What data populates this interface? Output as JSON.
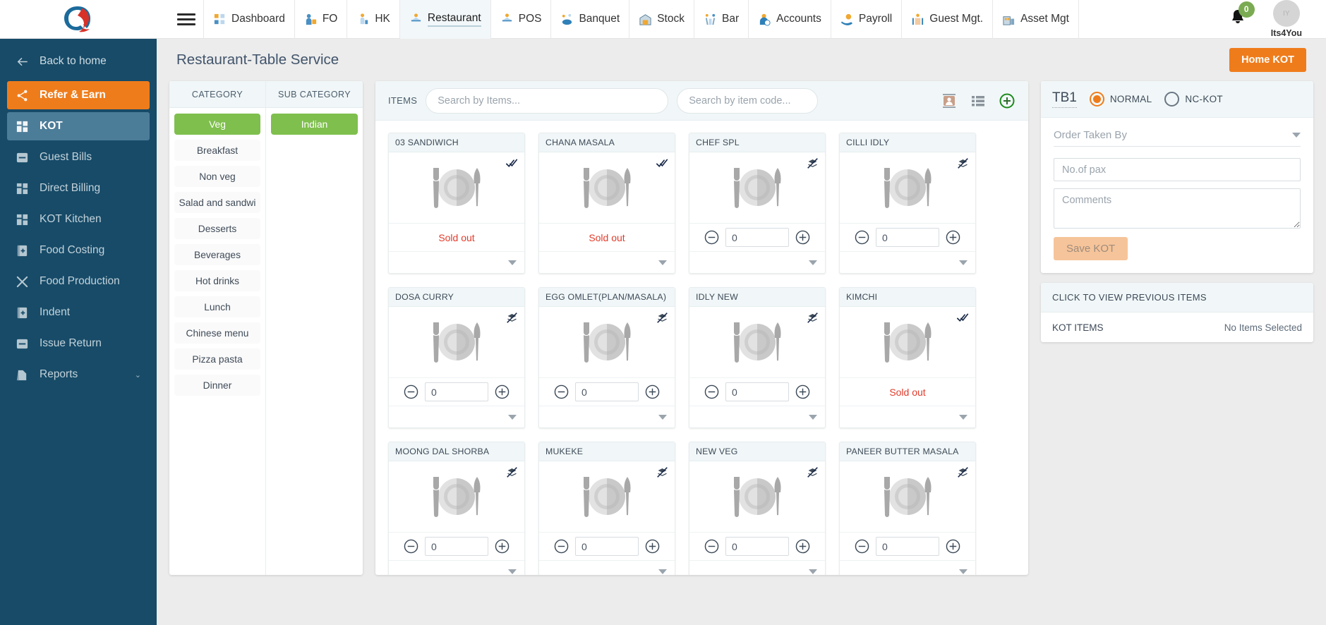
{
  "topnav": {
    "logo_alt": "qualitech-logo",
    "menu_items": [
      {
        "label": "Dashboard",
        "icon": "dashboard-icon",
        "active": false
      },
      {
        "label": "FO",
        "icon": "front-office-icon",
        "active": false
      },
      {
        "label": "HK",
        "icon": "housekeeping-icon",
        "active": false
      },
      {
        "label": "Restaurant",
        "icon": "restaurant-icon",
        "active": true
      },
      {
        "label": "POS",
        "icon": "pos-icon",
        "active": false
      },
      {
        "label": "Banquet",
        "icon": "banquet-icon",
        "active": false
      },
      {
        "label": "Stock",
        "icon": "stock-icon",
        "active": false
      },
      {
        "label": "Bar",
        "icon": "bar-icon",
        "active": false
      },
      {
        "label": "Accounts",
        "icon": "accounts-icon",
        "active": false
      },
      {
        "label": "Payroll",
        "icon": "payroll-icon",
        "active": false
      },
      {
        "label": "Guest Mgt.",
        "icon": "guest-management-icon",
        "active": false
      },
      {
        "label": "Asset Mgt",
        "icon": "asset-management-icon",
        "active": false
      }
    ],
    "notification_count": "0",
    "user_name": "Its4You",
    "avatar_initials": "IY"
  },
  "sidebar": {
    "back_label": "Back to home",
    "items": [
      {
        "label": "Refer & Earn",
        "icon": "share-icon",
        "state": "refer"
      },
      {
        "label": "KOT",
        "icon": "grid-icon",
        "state": "active"
      },
      {
        "label": "Guest Bills",
        "icon": "bill-icon",
        "state": ""
      },
      {
        "label": "Direct Billing",
        "icon": "grid-icon",
        "state": ""
      },
      {
        "label": "KOT Kitchen",
        "icon": "grid-icon",
        "state": ""
      },
      {
        "label": "Food Costing",
        "icon": "book-plus-icon",
        "state": ""
      },
      {
        "label": "Food Production",
        "icon": "fork-knife-cross-icon",
        "state": ""
      },
      {
        "label": "Indent",
        "icon": "book-plus-icon",
        "state": ""
      },
      {
        "label": "Issue Return",
        "icon": "bill-icon",
        "state": ""
      },
      {
        "label": "Reports",
        "icon": "reports-icon",
        "state": "",
        "caret": "⌄"
      }
    ]
  },
  "page": {
    "title": "Restaurant-Table Service",
    "home_kot_label": "Home KOT"
  },
  "category_panel": {
    "category_header": "CATEGORY",
    "subcategory_header": "SUB CATEGORY",
    "categories": [
      {
        "label": "Veg",
        "selected": true
      },
      {
        "label": "Breakfast",
        "selected": false
      },
      {
        "label": "Non veg",
        "selected": false
      },
      {
        "label": "Salad and sandwi",
        "selected": false
      },
      {
        "label": "Desserts",
        "selected": false
      },
      {
        "label": "Beverages",
        "selected": false
      },
      {
        "label": "Hot drinks",
        "selected": false
      },
      {
        "label": "Lunch",
        "selected": false
      },
      {
        "label": "Chinese menu",
        "selected": false
      },
      {
        "label": "Pizza pasta",
        "selected": false
      },
      {
        "label": "Dinner",
        "selected": false
      }
    ],
    "subcategories": [
      {
        "label": "Indian",
        "selected": true
      }
    ]
  },
  "items_panel": {
    "items_label": "ITEMS",
    "search_items_placeholder": "Search by Items...",
    "search_items_value": "",
    "search_code_placeholder": "Search by item code...",
    "search_code_value": "",
    "toolbar_icons": [
      "contact-card-icon",
      "list-view-icon",
      "add-circle-icon"
    ],
    "sold_out_text": "Sold out",
    "cards": [
      {
        "name": "03 SANDIWICH",
        "flag": "double-check-icon",
        "state": "soldout",
        "qty": ""
      },
      {
        "name": "CHANA MASALA",
        "flag": "double-check-icon",
        "state": "soldout",
        "qty": ""
      },
      {
        "name": "CHEF SPL",
        "flag": "layers-off-icon",
        "state": "stepper",
        "qty": "0"
      },
      {
        "name": "CILLI IDLY",
        "flag": "layers-off-icon",
        "state": "stepper",
        "qty": "0"
      },
      {
        "name": "DOSA CURRY",
        "flag": "layers-off-icon",
        "state": "stepper",
        "qty": "0"
      },
      {
        "name": "EGG OMLET(PLAN/MASALA)",
        "flag": "layers-off-icon",
        "state": "stepper",
        "qty": "0"
      },
      {
        "name": "IDLY NEW",
        "flag": "layers-off-icon",
        "state": "stepper",
        "qty": "0"
      },
      {
        "name": "KIMCHI",
        "flag": "double-check-icon",
        "state": "soldout",
        "qty": ""
      },
      {
        "name": "MOONG DAL SHORBA",
        "flag": "layers-off-icon",
        "state": "stepper",
        "qty": "0"
      },
      {
        "name": "MUKEKE",
        "flag": "layers-off-icon",
        "state": "stepper",
        "qty": "0"
      },
      {
        "name": "NEW VEG",
        "flag": "layers-off-icon",
        "state": "stepper",
        "qty": "0"
      },
      {
        "name": "PANEER BUTTER MASALA",
        "flag": "layers-off-icon",
        "state": "stepper",
        "qty": "0"
      }
    ]
  },
  "kot_panel": {
    "table_name": "TB1",
    "kot_types": [
      {
        "label": "NORMAL",
        "selected": true
      },
      {
        "label": "NC-KOT",
        "selected": false
      }
    ],
    "order_taken_by_placeholder": "Order Taken By",
    "order_taken_by_value": "",
    "pax_placeholder": "No.of pax",
    "pax_value": "",
    "comments_placeholder": "Comments",
    "comments_value": "",
    "save_label": "Save KOT"
  },
  "previous_panel": {
    "header": "CLICK TO VIEW PREVIOUS ITEMS",
    "kot_items_label": "KOT ITEMS",
    "kot_items_value": "No Items Selected"
  },
  "colors": {
    "sidebar_bg": "#174b68",
    "accent_orange": "#ef7c1b",
    "selected_green": "#7fbf4d",
    "soldout_red": "#e13b2b",
    "panel_header": "#f1f7f8"
  }
}
